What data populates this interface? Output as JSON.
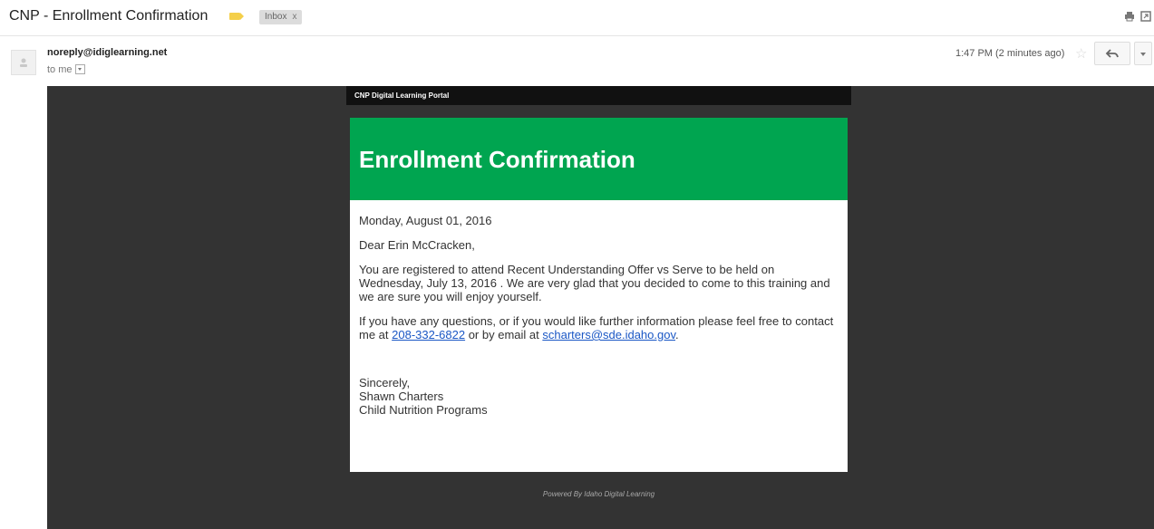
{
  "subject": "CNP - Enrollment Confirmation",
  "label_chip": {
    "label": "Inbox",
    "close": "x"
  },
  "sender": "noreply@idiglearning.net",
  "to": "to me",
  "time": "1:47 PM (2 minutes ago)",
  "icons": {
    "print": "print-icon",
    "new_window": "new-window-icon",
    "star": "star-icon",
    "reply": "reply-icon",
    "more": "chevron-down-icon",
    "label": "label-tag-icon"
  },
  "colors": {
    "green_header": "#00a550",
    "dark_bg": "#333333",
    "portal_bar": "#111111",
    "link": "#1a57c5"
  },
  "email": {
    "portal_title": "CNP Digital Learning Portal",
    "heading": "Enrollment Confirmation",
    "date": "Monday, August 01, 2016",
    "greeting": "Dear Erin McCracken,",
    "para1": "You are registered to attend Recent Understanding Offer vs Serve to be held on Wednesday, July 13, 2016 . We are very glad that you decided to come to this training and we are sure you will enjoy yourself.",
    "para2_a": "If you have any questions, or if you would like further information please feel free to contact me at ",
    "phone": "208-332-6822",
    "para2_b": " or by email at ",
    "email_link": "scharters@sde.idaho.gov",
    "para2_c": ".",
    "sign_off": "Sincerely,",
    "signer_name": "Shawn Charters",
    "signer_org": "Child Nutrition Programs",
    "footer": "Powered By Idaho Digital Learning"
  }
}
